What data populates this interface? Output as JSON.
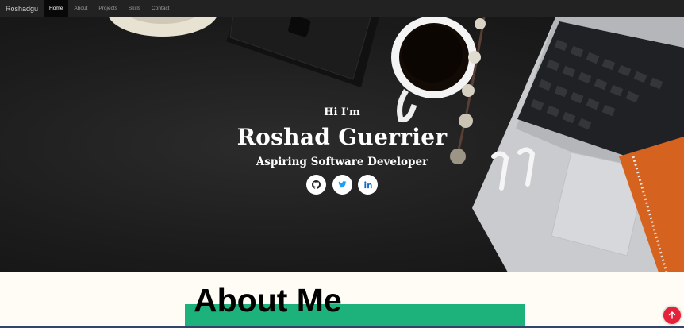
{
  "navbar": {
    "brand": "Roshadgu",
    "items": [
      {
        "label": "Home",
        "active": true
      },
      {
        "label": "About"
      },
      {
        "label": "Projects"
      },
      {
        "label": "Skills"
      },
      {
        "label": "Contact"
      }
    ]
  },
  "hero": {
    "greeting": "Hi I'm",
    "name": "Roshad Guerrier",
    "tagline": "Aspiring Software Developer",
    "socials": [
      {
        "icon": "github-icon",
        "color": "#222222"
      },
      {
        "icon": "twitter-icon",
        "color": "#1da1f2"
      },
      {
        "icon": "linkedin-icon",
        "color": "#0a66c2"
      }
    ]
  },
  "about": {
    "title": "About Me",
    "accent_color": "#1db27c"
  },
  "scroll_top": {
    "icon": "arrow-up-icon",
    "color": "#e6223b"
  }
}
